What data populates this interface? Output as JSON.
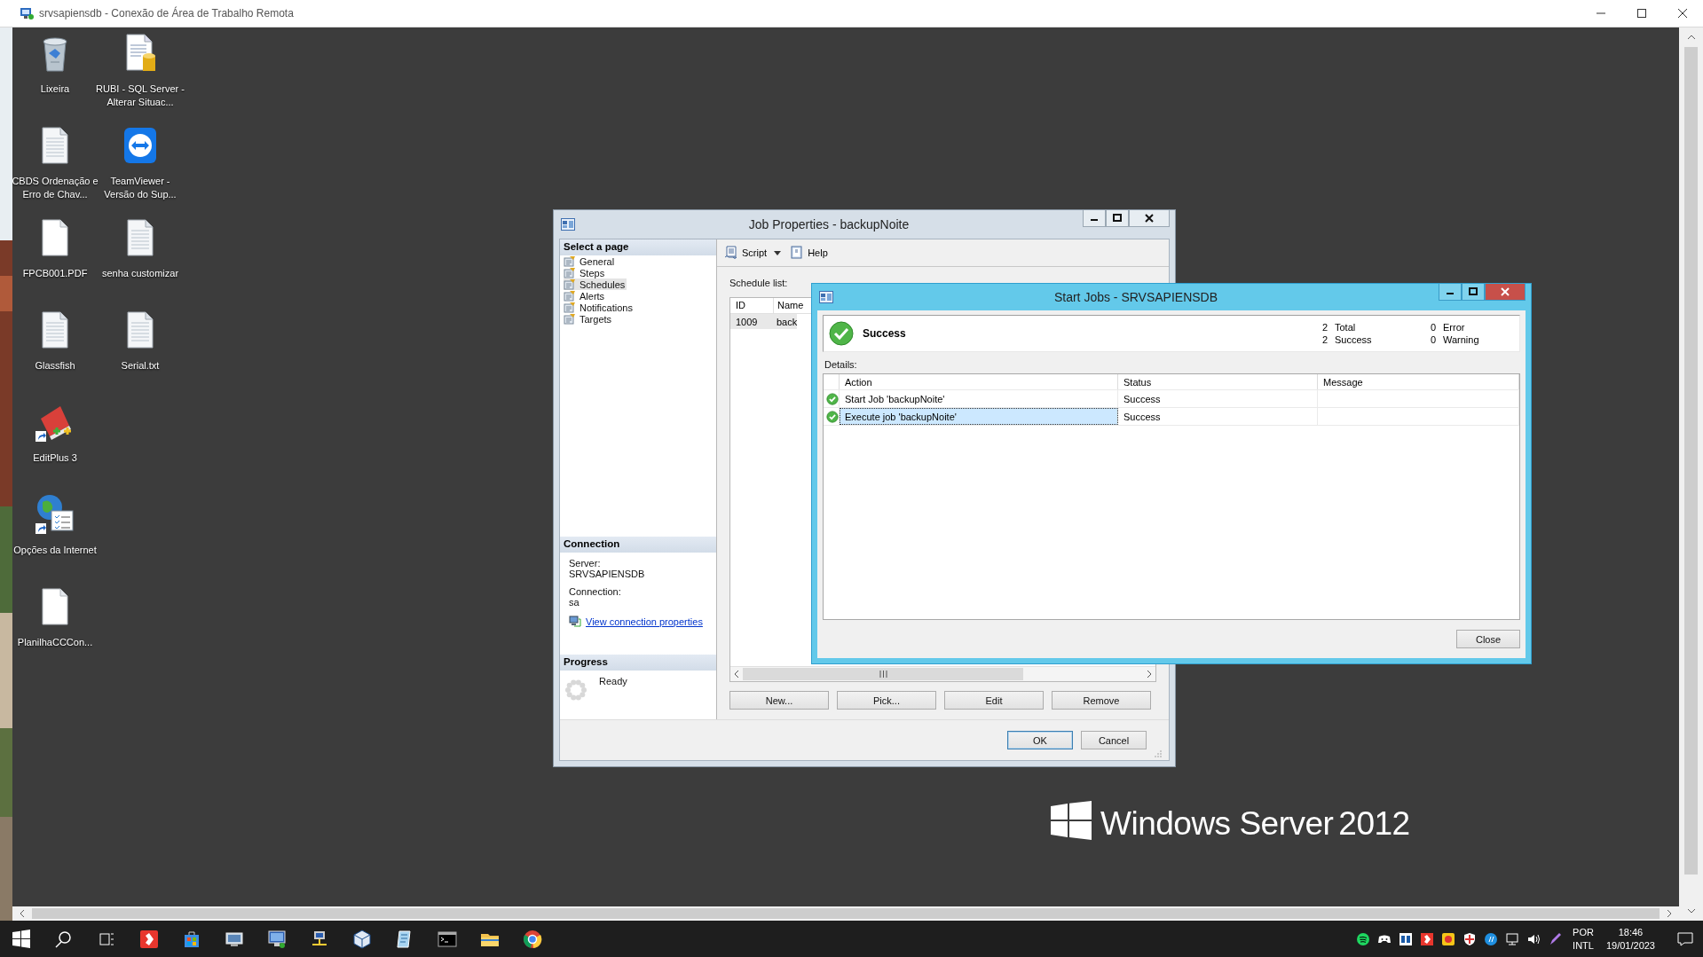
{
  "rdp_window": {
    "title": "srvsapiensdb - Conexão de Área de Trabalho Remota"
  },
  "desktop_columns": [
    [
      {
        "label": "Lixeira",
        "kind": "recycle"
      },
      {
        "label": "CBDS Ordenação e Erro de Chav...",
        "kind": "document"
      },
      {
        "label": "FPCB001.PDF",
        "kind": "blank"
      },
      {
        "label": "Glassfish",
        "kind": "document"
      },
      {
        "label": "EditPlus 3",
        "kind": "editplus"
      },
      {
        "label": "Opções da Internet",
        "kind": "internet"
      },
      {
        "label": "PlanilhaCCCon...",
        "kind": "blank"
      }
    ],
    [
      {
        "label": "RUBI - SQL Server - Alterar Situac...",
        "kind": "sqldoc"
      },
      {
        "label": "TeamViewer - Versão do Sup...",
        "kind": "teamviewer"
      },
      {
        "label": "senha customizar",
        "kind": "document"
      },
      {
        "label": "Serial.txt",
        "kind": "document"
      }
    ]
  ],
  "job_properties": {
    "title": "Job Properties - backupNoite",
    "select_page_header": "Select a page",
    "pages": [
      {
        "label": "General",
        "selected": false
      },
      {
        "label": "Steps",
        "selected": false
      },
      {
        "label": "Schedules",
        "selected": true
      },
      {
        "label": "Alerts",
        "selected": false
      },
      {
        "label": "Notifications",
        "selected": false
      },
      {
        "label": "Targets",
        "selected": false
      }
    ],
    "toolbar": [
      {
        "label": "Script",
        "kind": "script"
      },
      {
        "label": "Help",
        "kind": "help"
      }
    ],
    "schedule_list_label": "Schedule list:",
    "schedule_columns": [
      "ID",
      "Name"
    ],
    "schedule_rows": [
      {
        "cells": [
          "1009",
          "back"
        ],
        "selected": true
      }
    ],
    "connection": {
      "header": "Connection",
      "server_label": "Server:",
      "server": "SRVSAPIENSDB",
      "connection_label": "Connection:",
      "connection": "sa",
      "link": "View connection properties"
    },
    "progress": {
      "header": "Progress",
      "status": "Ready"
    },
    "list_buttons": [
      "New...",
      "Pick...",
      "Edit",
      "Remove"
    ],
    "dialog_buttons": [
      {
        "label": "OK",
        "default": true
      },
      {
        "label": "Cancel",
        "default": false
      }
    ]
  },
  "start_jobs": {
    "title": "Start Jobs - SRVSAPIENSDB",
    "result": "Success",
    "stats": [
      {
        "count": "2",
        "label": "Total"
      },
      {
        "count": "0",
        "label": "Error"
      },
      {
        "count": "2",
        "label": "Success"
      },
      {
        "count": "0",
        "label": "Warning"
      }
    ],
    "details_label": "Details:",
    "columns": [
      "Action",
      "Status",
      "Message"
    ],
    "rows": [
      {
        "action": "Start Job 'backupNoite'",
        "status": "Success",
        "selected": false
      },
      {
        "action": "Execute job 'backupNoite'",
        "status": "Success",
        "selected": true
      }
    ],
    "close_button": "Close"
  },
  "logo": {
    "name": "Windows Server",
    "version": "2012"
  },
  "taskbar": {
    "language": [
      "POR",
      "INTL"
    ],
    "time": "18:46",
    "date": "19/01/2023"
  }
}
